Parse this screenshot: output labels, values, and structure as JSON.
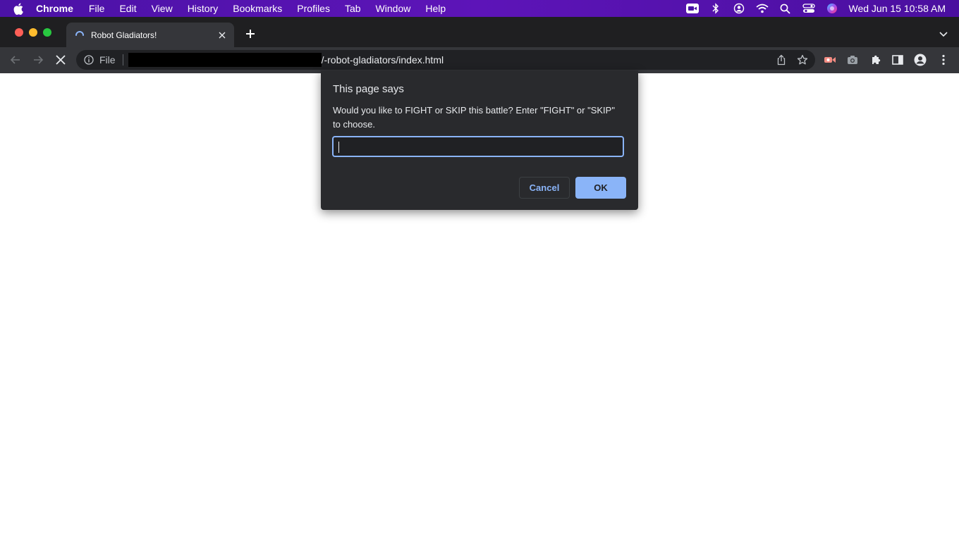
{
  "menubar": {
    "app_name": "Chrome",
    "items": [
      "File",
      "Edit",
      "View",
      "History",
      "Bookmarks",
      "Profiles",
      "Tab",
      "Window",
      "Help"
    ],
    "status_icons": [
      "video-icon",
      "bluetooth-icon",
      "user-circle-icon",
      "wifi-icon",
      "search-icon",
      "control-center-icon",
      "siri-icon"
    ],
    "clock": "Wed Jun 15  10:58 AM"
  },
  "tab": {
    "title": "Robot Gladiators!"
  },
  "omnibox": {
    "scheme_label": "File",
    "url_visible": "/-robot-gladiators/index.html"
  },
  "dialog": {
    "title": "This page says",
    "message": "Would you like to FIGHT or SKIP this battle? Enter \"FIGHT\" or \"SKIP\" to choose.",
    "input_value": "",
    "cancel_label": "Cancel",
    "ok_label": "OK"
  },
  "colors": {
    "menubar": "#5a0fb0",
    "accent": "#8ab4f8",
    "dialog_bg": "#292a2d",
    "toolbar_bg": "#35363a"
  }
}
